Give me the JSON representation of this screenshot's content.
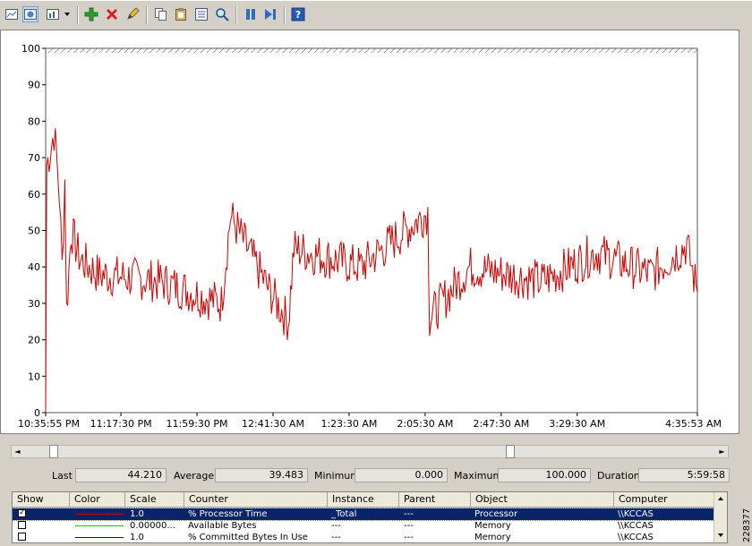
{
  "toolbar": {
    "icons": [
      "view-current-activity-icon",
      "view-log-data-icon",
      "change-graph-type-icon",
      "dropdown-arrow-icon",
      "add-counter-icon",
      "delete-counter-icon",
      "highlight-icon",
      "copy-properties-icon",
      "paste-counter-list-icon",
      "properties-icon",
      "zoom-icon",
      "freeze-display-icon",
      "update-data-icon",
      "help-icon"
    ]
  },
  "chart_data": {
    "type": "line",
    "title": "",
    "xlabel": "",
    "ylabel": "",
    "ylim": [
      0,
      100
    ],
    "yticks": [
      0,
      10,
      20,
      30,
      40,
      50,
      60,
      70,
      80,
      90,
      100
    ],
    "x_tick_labels": [
      "10:35:55 PM",
      "11:17:30 PM",
      "11:59:30 PM",
      "12:41:30 AM",
      "1:23:30 AM",
      "2:05:30 AM",
      "2:47:30 AM",
      "3:29:30 AM",
      "4:35:53 AM"
    ],
    "grid": false,
    "x_start": "10:35:55 PM",
    "x_end": "4:35:53 AM",
    "series": [
      {
        "name": "% Processor Time",
        "color": "#cc0000",
        "keypoints": [
          {
            "t": "10:35:55 PM",
            "v": 0
          },
          {
            "t": "10:36:30 PM",
            "v": 68
          },
          {
            "t": "10:38:30 PM",
            "v": 72
          },
          {
            "t": "10:40:30 PM",
            "v": 77
          },
          {
            "t": "10:42:00 PM",
            "v": 70
          },
          {
            "t": "10:43:30 PM",
            "v": 60
          },
          {
            "t": "10:45:00 PM",
            "v": 40
          },
          {
            "t": "10:46:30 PM",
            "v": 64
          },
          {
            "t": "10:47:30 PM",
            "v": 28
          },
          {
            "t": "10:50:00 PM",
            "v": 50
          },
          {
            "t": "10:55:00 PM",
            "v": 42
          },
          {
            "t": "11:05:00 PM",
            "v": 38
          },
          {
            "t": "11:40:00 PM",
            "v": 36
          },
          {
            "t": "12:13:00 AM",
            "v": 30
          },
          {
            "t": "12:18:00 AM",
            "v": 54
          },
          {
            "t": "12:40:00 AM",
            "v": 33
          },
          {
            "t": "12:50:00 AM",
            "v": 25
          },
          {
            "t": "12:53:00 AM",
            "v": 45
          },
          {
            "t": "1:30:00 AM",
            "v": 40
          },
          {
            "t": "2:07:00 AM",
            "v": 55
          },
          {
            "t": "2:08:00 AM",
            "v": 26
          },
          {
            "t": "2:30:00 AM",
            "v": 40
          },
          {
            "t": "3:10:00 AM",
            "v": 36
          },
          {
            "t": "3:40:00 AM",
            "v": 44
          },
          {
            "t": "4:10:00 AM",
            "v": 38
          },
          {
            "t": "4:30:00 AM",
            "v": 46
          },
          {
            "t": "4:35:53 AM",
            "v": 33
          }
        ],
        "mean": 39.483,
        "min": 0.0,
        "max": 100.0
      }
    ]
  },
  "scrollbar": {
    "left_arrow": "◄",
    "right_arrow": "►"
  },
  "stats": [
    {
      "label": "Last",
      "value": "44.210"
    },
    {
      "label": "Average",
      "value": "39.483"
    },
    {
      "label": "Minimum",
      "value": "0.000"
    },
    {
      "label": "Maximum",
      "value": "100.000"
    },
    {
      "label": "Duration",
      "value": "5:59:58"
    }
  ],
  "counter_table": {
    "columns": [
      "Show",
      "Color",
      "Scale",
      "Counter",
      "Instance",
      "Parent",
      "Object",
      "Computer"
    ],
    "rows": [
      {
        "show": true,
        "color": "#cc0000",
        "scale": "1.0",
        "counter": "% Processor Time",
        "instance": "_Total",
        "parent": "---",
        "object": "Processor",
        "computer": "\\\\KCCAS",
        "selected": true
      },
      {
        "show": false,
        "color": "#00cc00",
        "scale": "0.00000...",
        "counter": "Available Bytes",
        "instance": "---",
        "parent": "---",
        "object": "Memory",
        "computer": "\\\\KCCAS",
        "selected": false
      },
      {
        "show": false,
        "color": "#0000cc",
        "scale": "1.0",
        "counter": "% Committed Bytes In Use",
        "instance": "---",
        "parent": "---",
        "object": "Memory",
        "computer": "\\\\KCCAS",
        "selected": false
      }
    ]
  },
  "figure_id": "228377"
}
